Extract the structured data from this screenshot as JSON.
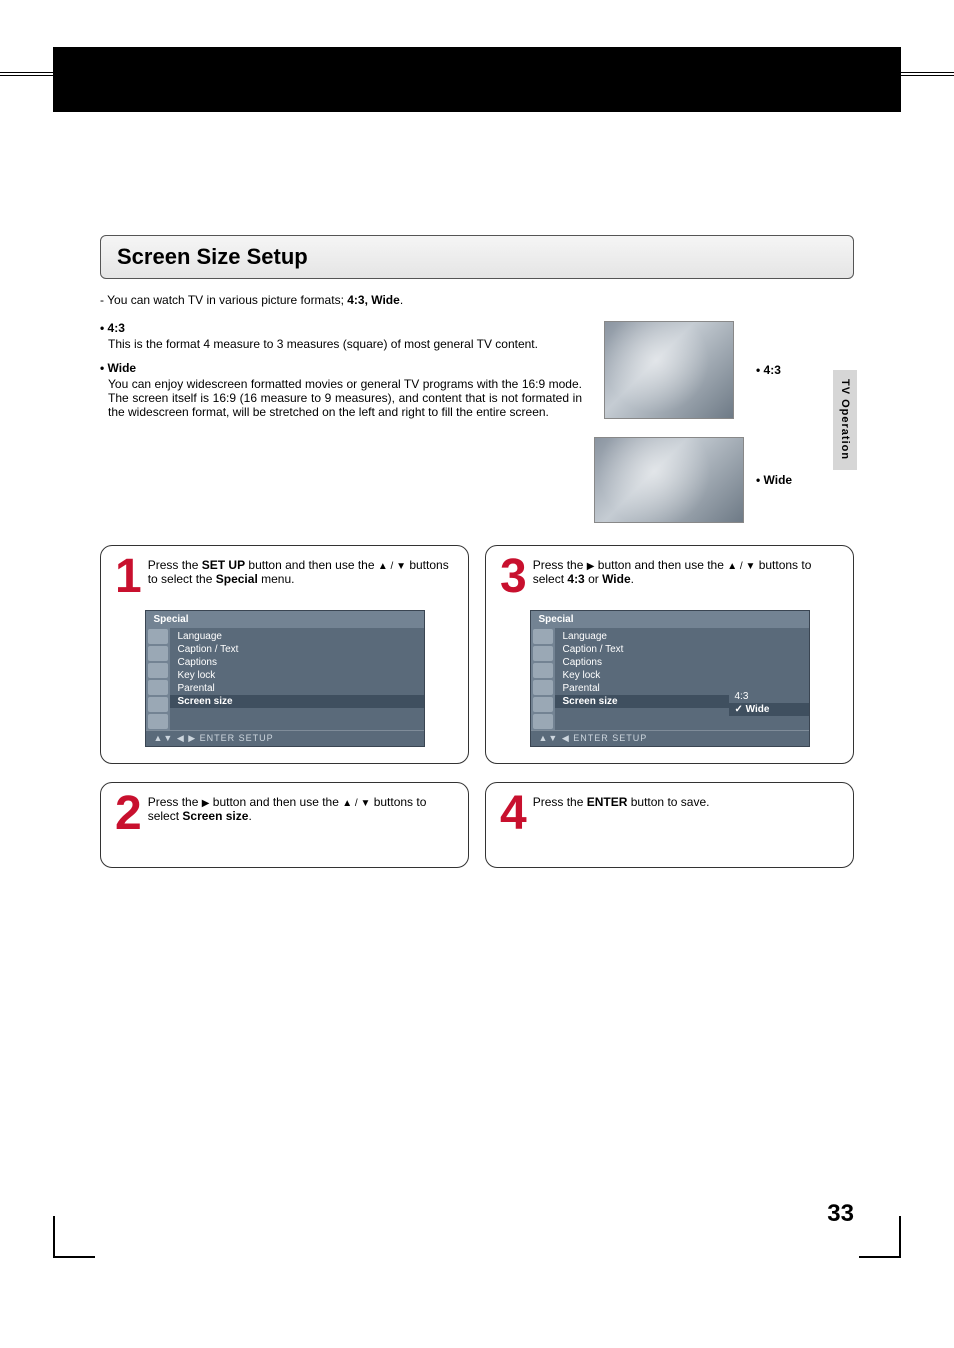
{
  "page": {
    "number": "33",
    "side_tab": "TV Operation"
  },
  "title": "Screen Size Setup",
  "intro_prefix": "- You can watch TV in various picture formats; ",
  "intro_bold": "4:3, Wide",
  "intro_suffix": ".",
  "formats": {
    "f43": {
      "bullet": "• 4:3",
      "desc": "This is the format 4 measure to 3 measures (square) of most general TV content.",
      "preview_label": "• 4:3"
    },
    "wide": {
      "bullet": "• Wide",
      "desc": "You can enjoy widescreen formatted movies or general TV programs with the 16:9 mode. The screen itself is 16:9 (16 measure to 9 measures), and content that is not formated in the widescreen format, will be stretched on the left and right to fill the entire screen.",
      "preview_label": "• Wide"
    }
  },
  "steps": {
    "s1": {
      "num": "1",
      "t1": "Press the ",
      "b1": "SET UP",
      "t2": " button and then use the ",
      "arrows": "▲ / ▼",
      "t3": " buttons to select the ",
      "b2": "Special",
      "t4": " menu."
    },
    "s2": {
      "num": "2",
      "t1": "Press the ",
      "arrow_r": "▶",
      "t2": " button and then use the ",
      "arrows": "▲ / ▼",
      "t3": " buttons to select ",
      "b1": "Screen size",
      "t4": "."
    },
    "s3": {
      "num": "3",
      "t1": "Press the ",
      "arrow_r": "▶",
      "t2": " button and then use the ",
      "arrows": "▲ / ▼",
      "t3": " buttons to select ",
      "b1": "4:3",
      "t4": " or ",
      "b2": "Wide",
      "t5": "."
    },
    "s4": {
      "num": "4",
      "t1": "Press the ",
      "b1": "ENTER",
      "t2": " button to save."
    }
  },
  "menu1": {
    "header": "Special",
    "items": [
      "Language",
      "Caption / Text",
      "Captions",
      "Key lock",
      "Parental",
      "Screen size"
    ],
    "selected_index": 5,
    "footer": "▲▼  ◀ ▶  ENTER   SETUP"
  },
  "menu2": {
    "header": "Special",
    "items": [
      "Language",
      "Caption / Text",
      "Captions",
      "Key lock",
      "Parental",
      "Screen size"
    ],
    "selected_index": 5,
    "values": [
      "4:3",
      "Wide"
    ],
    "value_selected_index": 1,
    "footer": "▲▼  ◀  ENTER   SETUP"
  }
}
